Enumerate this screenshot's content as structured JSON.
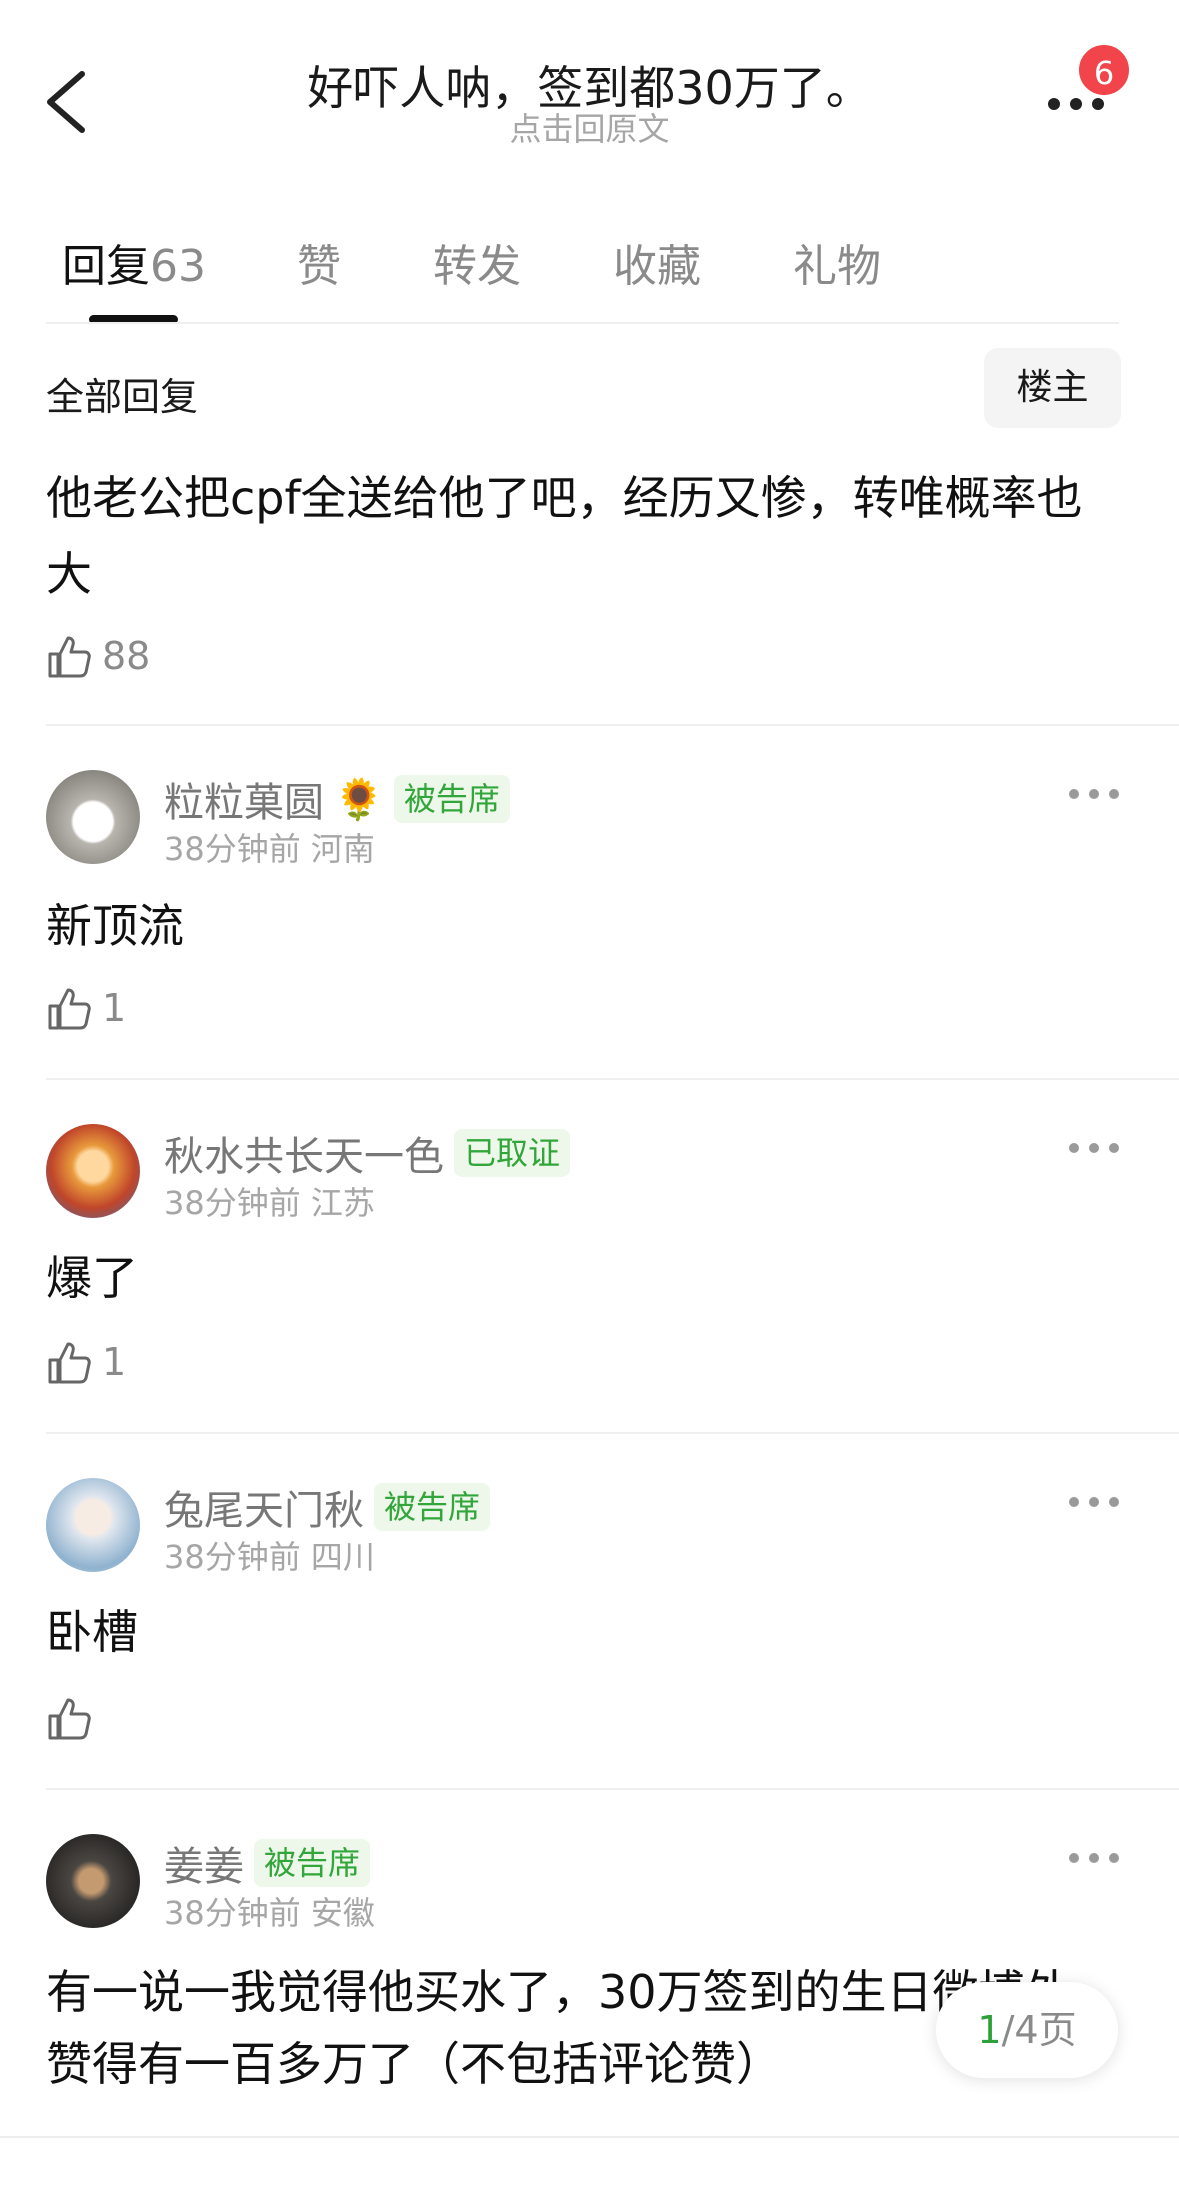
{
  "header": {
    "title": "好吓人呐，签到都30万了。",
    "subtitle": "点击回原文",
    "badge_count": "6"
  },
  "tabs": [
    {
      "label": "回复",
      "count": "63",
      "active": true
    },
    {
      "label": "赞"
    },
    {
      "label": "转发"
    },
    {
      "label": "收藏"
    },
    {
      "label": "礼物"
    }
  ],
  "section": {
    "all_replies": "全部回复",
    "owner_only": "楼主"
  },
  "main_comment": {
    "text": "他老公把cpf全送给他了吧，经历又惨，转唯概率也大",
    "likes": "88"
  },
  "comments": [
    {
      "name": "粒粒菓圆",
      "emoji": "🌻",
      "tag": "被告席",
      "time": "38分钟前",
      "location": "河南",
      "text": "新顶流",
      "likes": "1",
      "avatar_color": "#b8b4ae"
    },
    {
      "name": "秋水共长天一色",
      "tag": "已取证",
      "time": "38分钟前",
      "location": "江苏",
      "text": "爆了",
      "likes": "1",
      "avatar_color": "#e89a3c"
    },
    {
      "name": "兔尾天门秋",
      "tag": "被告席",
      "time": "38分钟前",
      "location": "四川",
      "text": "卧槽",
      "likes": "",
      "avatar_color": "#dfe6ee"
    },
    {
      "name": "姜姜",
      "tag": "被告席",
      "time": "38分钟前",
      "location": "安徽",
      "text": "有一说一我觉得他买水了，30万签到的生日微博外赞得有一百多万了（不包括评论赞）",
      "likes": "",
      "avatar_color": "#4a4642"
    }
  ],
  "pager": {
    "current": "1",
    "total": "/4页"
  },
  "colors": {
    "tag_green": "#32a63a",
    "badge_red": "#f2454b"
  }
}
